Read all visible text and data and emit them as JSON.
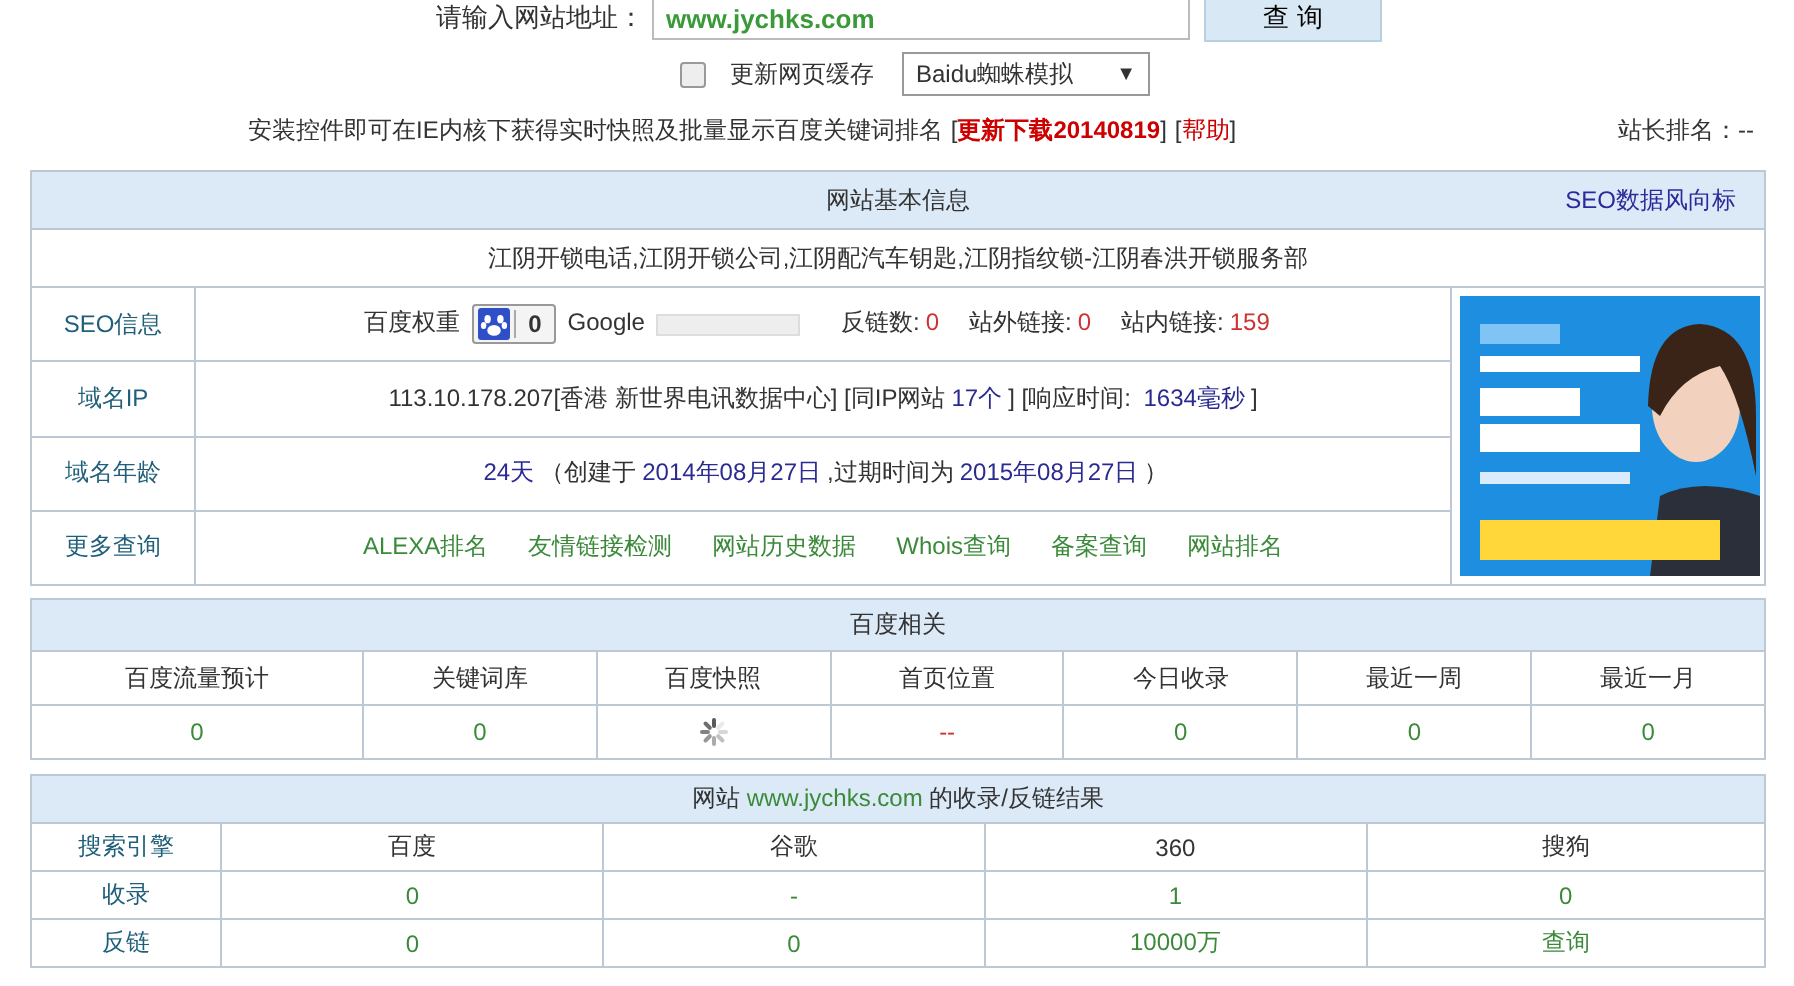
{
  "search": {
    "label": "请输入网站地址：",
    "value": "www.jychks.com",
    "button": "查 询"
  },
  "options": {
    "cache_label": "更新网页缓存",
    "cache_checked": false,
    "spider_value": "Baidu蜘蛛模拟",
    "dropdown_arrow": "▼"
  },
  "notice": {
    "text": "安装控件即可在IE内核下获得实时快照及批量显示百度关键词排名",
    "open": "[",
    "close": "]",
    "download_link": "更新下载20140819",
    "help_link": "帮助",
    "rank_label": "站长排名：--"
  },
  "basic_info": {
    "title": "网站基本信息",
    "trend_link": "SEO数据风向标",
    "site_title": "江阴开锁电话,江阴开锁公司,江阴配汽车钥匙,江阴指纹锁-江阴春洪开锁服务部",
    "rows": [
      {
        "kind": "seo",
        "label": "SEO信息",
        "baidu_label": "百度权重",
        "baidu_value": "0",
        "google_label": "Google",
        "google_rank": {
          "level": 0
        },
        "stats": [
          {
            "label": "反链数:",
            "value": "0"
          },
          {
            "label": "站外链接:",
            "value": "0"
          },
          {
            "label": "站内链接:",
            "value": "159"
          }
        ]
      },
      {
        "kind": "ip",
        "label": "域名IP",
        "ip": "113.10.178.207",
        "location": "[香港 新世界电讯数据中心]",
        "same_ip_pre": "[同IP网站",
        "same_ip_count": "17个",
        "same_ip_post": "]",
        "response_pre": "[响应时间: ",
        "response_value": "1634毫秒",
        "response_post": "]"
      },
      {
        "kind": "age",
        "label": "域名年龄",
        "age": "24天",
        "created_pre": "（创建于",
        "created": "2014年08月27日",
        "expire_pre": ",过期时间为",
        "expire": "2015年08月27日",
        "close": "）"
      },
      {
        "kind": "links",
        "label": "更多查询",
        "links": [
          "ALEXA排名",
          "友情链接检测",
          "网站历史数据",
          "Whois查询",
          "备案查询",
          "网站排名"
        ]
      }
    ]
  },
  "baidu": {
    "title": "百度相关",
    "columns": [
      "百度流量预计",
      "关键词库",
      "百度快照",
      "首页位置",
      "今日收录",
      "最近一周",
      "最近一月"
    ],
    "values": [
      {
        "kind": "number",
        "text": "0"
      },
      {
        "kind": "number",
        "text": "0"
      },
      {
        "kind": "loading"
      },
      {
        "kind": "empty",
        "text": "--"
      },
      {
        "kind": "number",
        "text": "0"
      },
      {
        "kind": "number",
        "text": "0"
      },
      {
        "kind": "number",
        "text": "0"
      }
    ]
  },
  "results": {
    "title_pre": "网站",
    "title_site": "www.jychks.com",
    "title_post": "的收录/反链结果",
    "columns": [
      "搜索引擎",
      "百度",
      "谷歌",
      "360",
      "搜狗"
    ],
    "rows": [
      {
        "cells": [
          "收录",
          "0",
          "-",
          "1",
          "0"
        ]
      },
      {
        "cells": [
          "反链",
          "0",
          "0",
          "10000万",
          "查询"
        ]
      }
    ]
  }
}
